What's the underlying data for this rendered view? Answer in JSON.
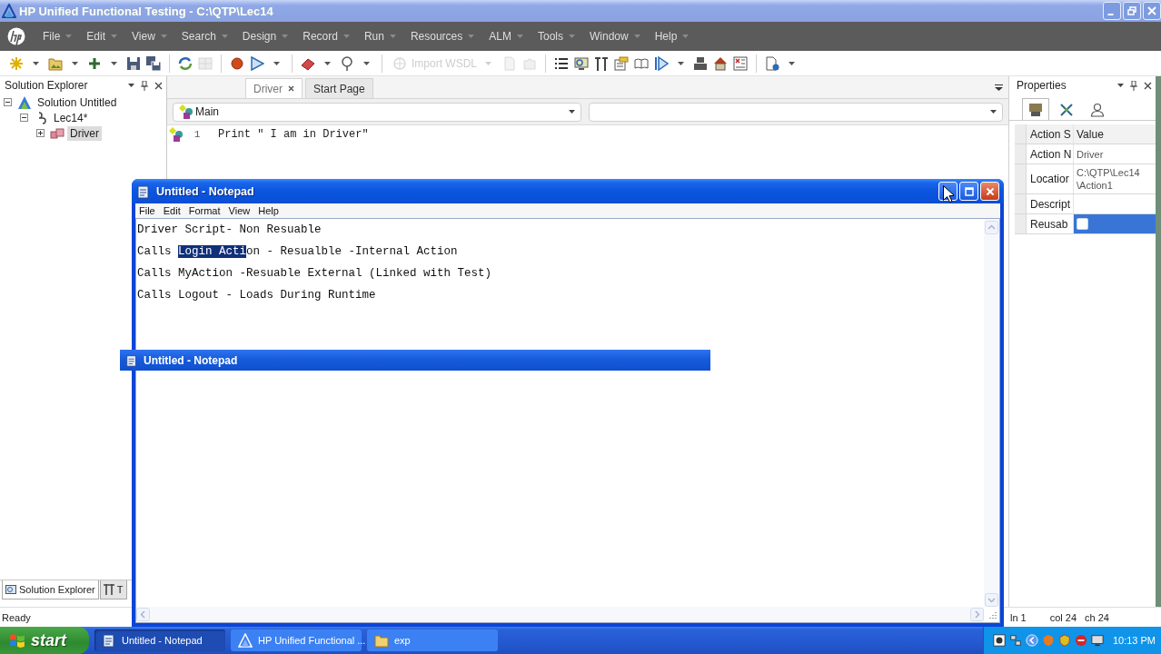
{
  "window": {
    "title": "HP Unified Functional Testing - C:\\QTP\\Lec14"
  },
  "menu": [
    "File",
    "Edit",
    "View",
    "Search",
    "Design",
    "Record",
    "Run",
    "Resources",
    "ALM",
    "Tools",
    "Window",
    "Help"
  ],
  "toolbar": {
    "import_button": {
      "label": "Import WSDL",
      "disabled": true
    }
  },
  "solution_explorer": {
    "title": "Solution Explorer",
    "tree": [
      {
        "label": "Solution Untitled",
        "expanded": true,
        "selected": false,
        "children": [
          {
            "label": "Lec14*",
            "expanded": true,
            "selected": false,
            "children": [
              {
                "label": "Driver",
                "expanded": false,
                "selected": true
              }
            ]
          }
        ]
      }
    ],
    "bottom_tabs": [
      {
        "label": "Solution Explorer",
        "selected": true
      },
      {
        "label": "T",
        "selected": false
      }
    ]
  },
  "editor": {
    "tabs": [
      {
        "label": "Driver",
        "selected": true,
        "closable": true
      },
      {
        "label": "Start Page",
        "selected": false,
        "closable": false
      }
    ],
    "action_combo": {
      "value": "Main"
    },
    "lines": [
      {
        "number": "1",
        "code": "Print \" I am in Driver\""
      }
    ]
  },
  "properties": {
    "title": "Properties",
    "tabs": [
      {
        "selected": true
      },
      {
        "selected": false
      },
      {
        "selected": false
      }
    ],
    "columns": [
      "Action S",
      "Value"
    ],
    "rows": [
      {
        "name": "Action N",
        "kind": "text",
        "value": [
          "Driver"
        ],
        "selected": false
      },
      {
        "name": "Locatior",
        "kind": "text",
        "value": [
          "C:\\QTP\\Lec14",
          "\\Action1"
        ],
        "selected": false
      },
      {
        "name": "Descript",
        "kind": "text",
        "selected": false
      },
      {
        "name": "Reusab",
        "kind": "checkbox",
        "checked": false,
        "selected": true
      }
    ]
  },
  "status_bar": {
    "text": "Ready",
    "ln": "ln 1",
    "col": "col 24",
    "ch": "ch 24"
  },
  "notepad": {
    "title": "Untitled - Notepad",
    "menu": [
      "File",
      "Edit",
      "Format",
      "View",
      "Help"
    ],
    "lines": [
      {
        "parts": [
          {
            "text": "Driver Script- Non Resuable",
            "selected": false
          }
        ]
      },
      {
        "parts": [
          {
            "text": "Calls ",
            "selected": false
          },
          {
            "text": "Login Acti",
            "selected": true
          },
          {
            "text": "on - Resualble -Internal Action",
            "selected": false
          }
        ]
      },
      {
        "parts": [
          {
            "text": "Calls MyAction -Resuable External (Linked with Test)",
            "selected": false
          }
        ]
      },
      {
        "parts": [
          {
            "text": "Calls Logout - Loads During Runtime",
            "selected": false
          }
        ]
      }
    ]
  },
  "drag_ghost": {
    "title": "Untitled - Notepad"
  },
  "taskbar": {
    "start": "start",
    "tasks": [
      {
        "label": "Untitled - Notepad",
        "selected": true
      },
      {
        "label": "HP Unified Functional ...",
        "selected": false
      },
      {
        "label": "exp",
        "selected": false
      }
    ],
    "clock": "10:13 PM"
  }
}
